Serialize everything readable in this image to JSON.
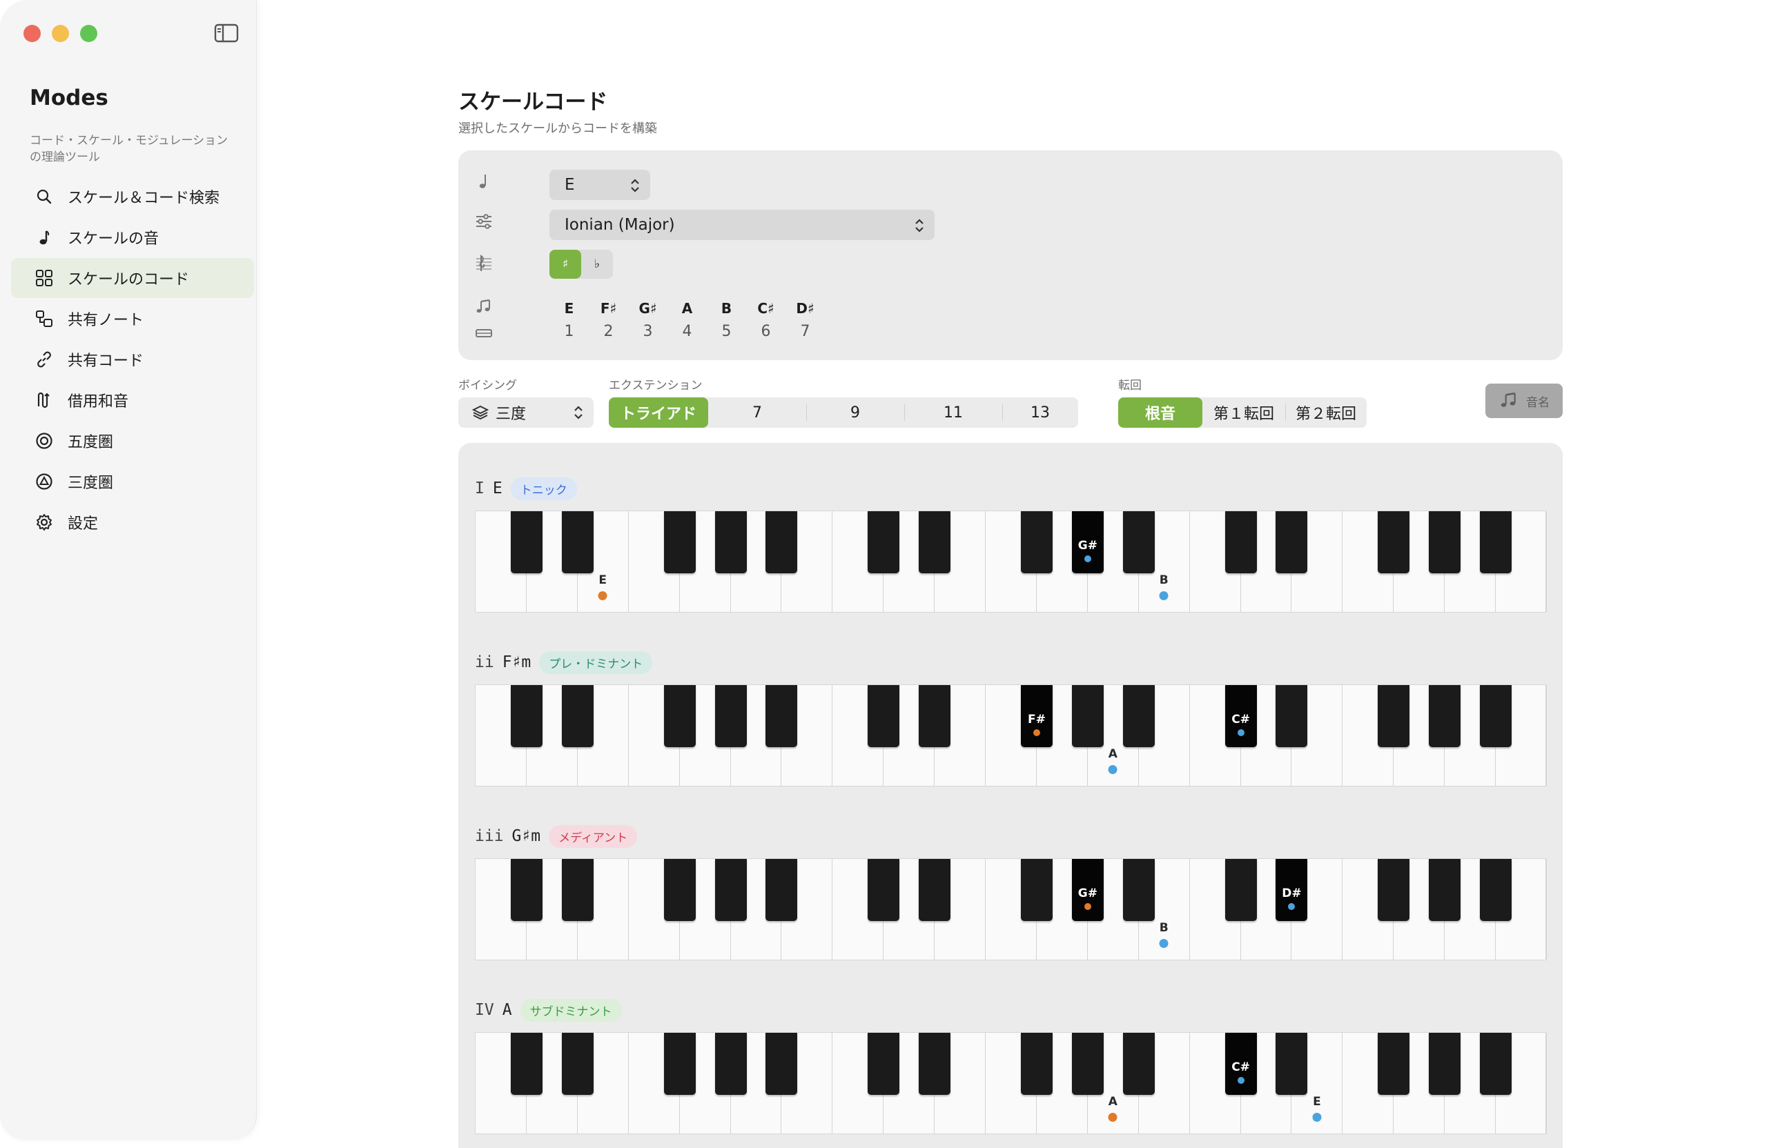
{
  "app": {
    "title": "Modes",
    "subtitle": "コード・スケール・モジュレーションの理論ツール"
  },
  "sidebar": {
    "items": [
      {
        "label": "スケール＆コード検索",
        "icon": "search-icon"
      },
      {
        "label": "スケールの音",
        "icon": "music-note-icon"
      },
      {
        "label": "スケールのコード",
        "icon": "grid-icon"
      },
      {
        "label": "共有ノート",
        "icon": "shared-notes-icon"
      },
      {
        "label": "共有コード",
        "icon": "link-icon"
      },
      {
        "label": "借用和音",
        "icon": "borrowed-chord-icon"
      },
      {
        "label": "五度圏",
        "icon": "circle-of-fifths-icon"
      },
      {
        "label": "三度圏",
        "icon": "circle-of-thirds-icon"
      },
      {
        "label": "設定",
        "icon": "gear-icon"
      }
    ],
    "active_index": 2
  },
  "page": {
    "title": "スケールコード",
    "subtitle": "選択したスケールからコードを構築"
  },
  "settings": {
    "root": "E",
    "mode": "Ionian (Major)",
    "accidentals": [
      "♯",
      "♭"
    ],
    "accidental_selected": "♯",
    "scale_notes": [
      "E",
      "F♯",
      "G♯",
      "A",
      "B",
      "C♯",
      "D♯"
    ],
    "degrees": [
      "1",
      "2",
      "3",
      "4",
      "5",
      "6",
      "7"
    ]
  },
  "controls": {
    "voicing_label": "ボイシング",
    "voicing_value": "三度",
    "extension_label": "エクステンション",
    "extensions": [
      "トライアド",
      "7",
      "9",
      "11",
      "13"
    ],
    "extension_selected": "トライアド",
    "inversion_label": "転回",
    "inversions": [
      "根音",
      "第１転回",
      "第２転回"
    ],
    "inversion_selected": "根音",
    "note_names_button": "音名"
  },
  "colors": {
    "accent": "#7cb342",
    "root_dot": "#e07b2a",
    "tone_dot": "#4aa3e0"
  },
  "chords": [
    {
      "numeral": "I",
      "name": "E",
      "function": "トニック",
      "badge_bg": "#dbe6f7",
      "badge_fg": "#3b6fd0",
      "notes": [
        {
          "key": "E",
          "octave": 0,
          "root": true
        },
        {
          "key": "G#",
          "octave": 1,
          "root": false
        },
        {
          "key": "B",
          "octave": 1,
          "root": false
        }
      ]
    },
    {
      "numeral": "ii",
      "name": "F♯m",
      "function": "プレ・ドミナント",
      "badge_bg": "#d6ebe5",
      "badge_fg": "#2e8a70",
      "notes": [
        {
          "key": "F#",
          "octave": 1,
          "root": true
        },
        {
          "key": "A",
          "octave": 1,
          "root": false
        },
        {
          "key": "C#",
          "octave": 2,
          "root": false
        }
      ]
    },
    {
      "numeral": "iii",
      "name": "G♯m",
      "function": "メディアント",
      "badge_bg": "#f6dadf",
      "badge_fg": "#d03a52",
      "notes": [
        {
          "key": "G#",
          "octave": 1,
          "root": true
        },
        {
          "key": "B",
          "octave": 1,
          "root": false
        },
        {
          "key": "D#",
          "octave": 2,
          "root": false
        }
      ]
    },
    {
      "numeral": "IV",
      "name": "A",
      "function": "サブドミナント",
      "badge_bg": "#dcefd8",
      "badge_fg": "#3f9a44",
      "notes": [
        {
          "key": "A",
          "octave": 1,
          "root": true
        },
        {
          "key": "C#",
          "octave": 2,
          "root": false
        },
        {
          "key": "E",
          "octave": 2,
          "root": false
        }
      ]
    }
  ]
}
